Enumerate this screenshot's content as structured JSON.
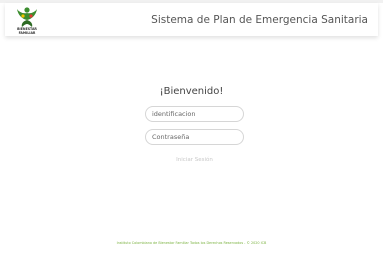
{
  "header": {
    "logo_icon": "bienestar-familiar-logo",
    "logo_text_line1": "BIENESTAR",
    "logo_text_line2": "FAMILIAR",
    "title": "Sistema de Plan de Emergencia Sanitaria"
  },
  "login": {
    "welcome": "¡Bienvenido!",
    "identification_placeholder": "identificacion",
    "password_placeholder": "Contraseña",
    "submit_label": "Iniciar Sesión"
  },
  "footer": {
    "text": "Instituto Colombiano de Bienestar Familiar Todos los Derechos Reservados - © 2020 ICB"
  },
  "colors": {
    "brand_green": "#3c8d2f",
    "footer_green": "#7cb342",
    "title_gray": "#555555"
  }
}
